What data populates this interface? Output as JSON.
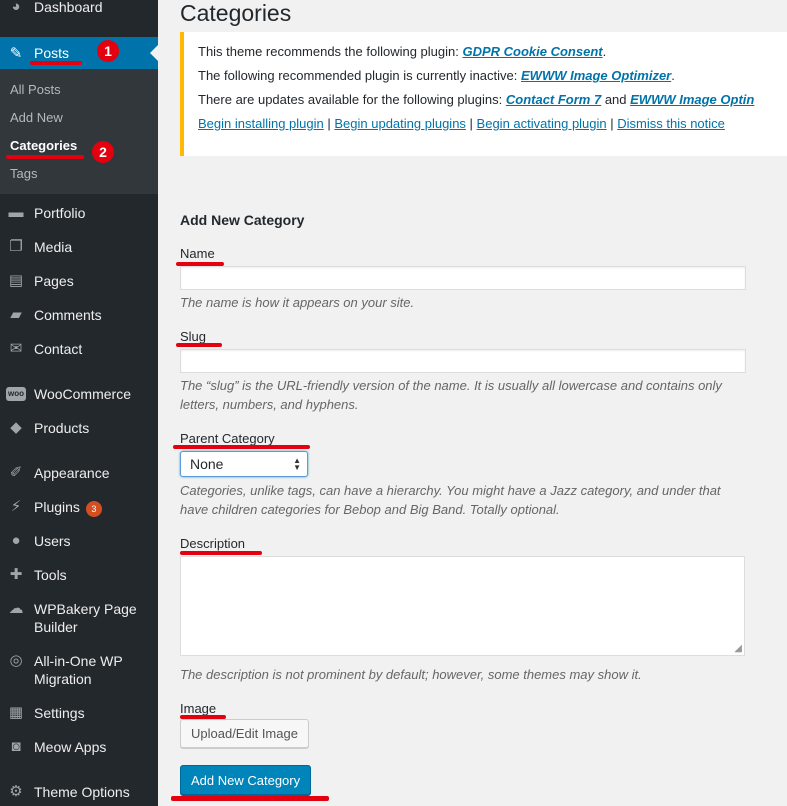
{
  "sidebar": {
    "items": [
      {
        "label": "Dashboard",
        "icon": "dashboard-icon",
        "glyph": "◕"
      },
      {
        "label": "Posts",
        "icon": "pin-icon",
        "glyph": "✎"
      },
      {
        "label": "Portfolio",
        "icon": "folder-icon",
        "glyph": "▬"
      },
      {
        "label": "Media",
        "icon": "media-icon",
        "glyph": "❐"
      },
      {
        "label": "Pages",
        "icon": "pages-icon",
        "glyph": "▤"
      },
      {
        "label": "Comments",
        "icon": "comment-icon",
        "glyph": "▰"
      },
      {
        "label": "Contact",
        "icon": "mail-icon",
        "glyph": "✉"
      },
      {
        "label": "WooCommerce",
        "icon": "woocommerce-icon",
        "glyph": "woo"
      },
      {
        "label": "Products",
        "icon": "box-icon",
        "glyph": "◆"
      },
      {
        "label": "Appearance",
        "icon": "brush-icon",
        "glyph": "✐"
      },
      {
        "label": "Plugins",
        "icon": "plugin-icon",
        "glyph": "⚡",
        "badge": "3"
      },
      {
        "label": "Users",
        "icon": "user-icon",
        "glyph": "●"
      },
      {
        "label": "Tools",
        "icon": "wrench-icon",
        "glyph": "✚"
      },
      {
        "label": "WPBakery Page Builder",
        "icon": "cloud-icon",
        "glyph": "☁"
      },
      {
        "label": "All-in-One WP Migration",
        "icon": "migration-icon",
        "glyph": "◎"
      },
      {
        "label": "Settings",
        "icon": "settings-icon",
        "glyph": "▦"
      },
      {
        "label": "Meow Apps",
        "icon": "camera-icon",
        "glyph": "◙"
      },
      {
        "label": "Theme Options",
        "icon": "gear-icon",
        "glyph": "⚙"
      }
    ],
    "submenu": [
      "All Posts",
      "Add New",
      "Categories",
      "Tags"
    ]
  },
  "annotations": {
    "step1": "1",
    "step2": "2"
  },
  "page": {
    "title": "Categories"
  },
  "notice": {
    "line1_prefix": "This theme recommends the following plugin: ",
    "line1_link": "GDPR Cookie Consent",
    "line1_suffix": ".",
    "line2_prefix": "The following recommended plugin is currently inactive: ",
    "line2_link": "EWWW Image Optimizer",
    "line2_suffix": ".",
    "line3_prefix": "There are updates available for the following plugins: ",
    "line3_link1": "Contact Form 7",
    "line3_and": " and ",
    "line3_link2": "EWWW Image Optin",
    "actions": [
      "Begin installing plugin",
      "Begin updating plugins",
      "Begin activating plugin",
      "Dismiss this notice"
    ],
    "separator": " | "
  },
  "form": {
    "heading": "Add New Category",
    "name_label": "Name",
    "name_help": "The name is how it appears on your site.",
    "slug_label": "Slug",
    "slug_help_1": "The “slug” is the URL-friendly version of the name. It is usually all lowercase and contains only",
    "slug_help_2": "letters, numbers, and hyphens.",
    "parent_label": "Parent Category",
    "parent_value": "None",
    "parent_help_1": "Categories, unlike tags, can have a hierarchy. You might have a Jazz category, and under that",
    "parent_help_2": "have children categories for Bebop and Big Band. Totally optional.",
    "description_label": "Description",
    "description_help": "The description is not prominent by default; however, some themes may show it.",
    "image_label": "Image",
    "upload_button": "Upload/Edit Image",
    "submit_button": "Add New Category"
  },
  "colors": {
    "sidebar": "#23282d",
    "active": "#0073aa",
    "annotation": "#e3000f",
    "notice_border": "#ffb900",
    "primary_button": "#0085ba"
  }
}
